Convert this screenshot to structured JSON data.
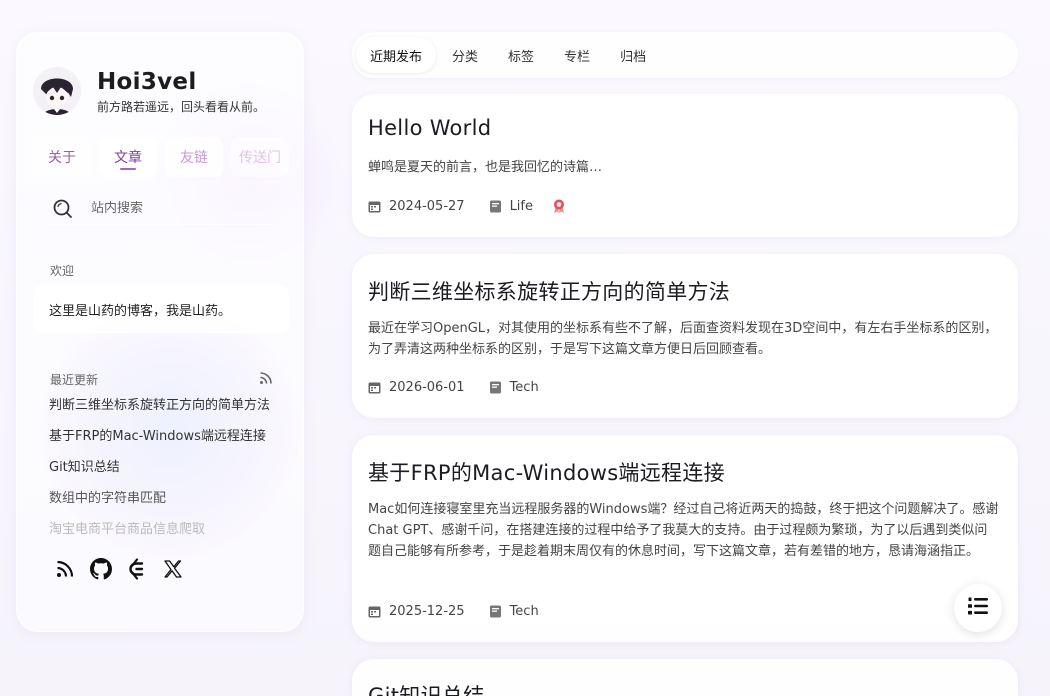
{
  "site": {
    "title": "Hoi3vel",
    "motto": "前方路若遥远，回头看看从前。"
  },
  "nav": {
    "about": "关于",
    "posts": "文章",
    "friends": "友链",
    "portal": "传送门"
  },
  "search": {
    "placeholder": "站内搜索"
  },
  "welcome": {
    "label": "欢迎",
    "text": "这里是山药的博客，我是山药。"
  },
  "recent": {
    "label": "最近更新",
    "items": [
      "判断三维坐标系旋转正方向的简单方法",
      "基于FRP的Mac-Windows端远程连接",
      "Git知识总结",
      "数组中的字符串匹配",
      "淘宝电商平台商品信息爬取"
    ]
  },
  "social": [
    "rss-icon",
    "github-icon",
    "gitee-icon",
    "x-icon"
  ],
  "tabs": [
    "近期发布",
    "分类",
    "标签",
    "专栏",
    "归档"
  ],
  "posts": [
    {
      "title": "Hello World",
      "excerpt": "蝉鸣是夏天的前言，也是我回忆的诗篇…",
      "date": "2024-05-27",
      "category": "Life",
      "pinned": true
    },
    {
      "title": "判断三维坐标系旋转正方向的简单方法",
      "excerpt": "最近在学习OpenGL，对其使用的坐标系有些不了解，后面查资料发现在3D空间中，有左右手坐标系的区别，为了弄清这两种坐标系的区别，于是写下这篇文章方便日后回顾查看。",
      "date": "2026-06-01",
      "category": "Tech"
    },
    {
      "title": "基于FRP的Mac-Windows端远程连接",
      "excerpt": "Mac如何连接寝室里充当远程服务器的Windows端？经过自己将近两天的捣鼓，终于把这个问题解决了。感谢Chat GPT、感谢千问，在搭建连接的过程中给予了我莫大的支持。由于过程颇为繁琐，为了以后遇到类似问题自己能够有所参考，于是趁着期末周仅有的休息时间，写下这篇文章，若有差错的地方，恳请海涵指正。",
      "date": "2025-12-25",
      "category": "Tech"
    },
    {
      "title": "Git知识总结"
    }
  ],
  "colors": {
    "accent": "#9a5fb3",
    "pin": "#e0505b"
  }
}
